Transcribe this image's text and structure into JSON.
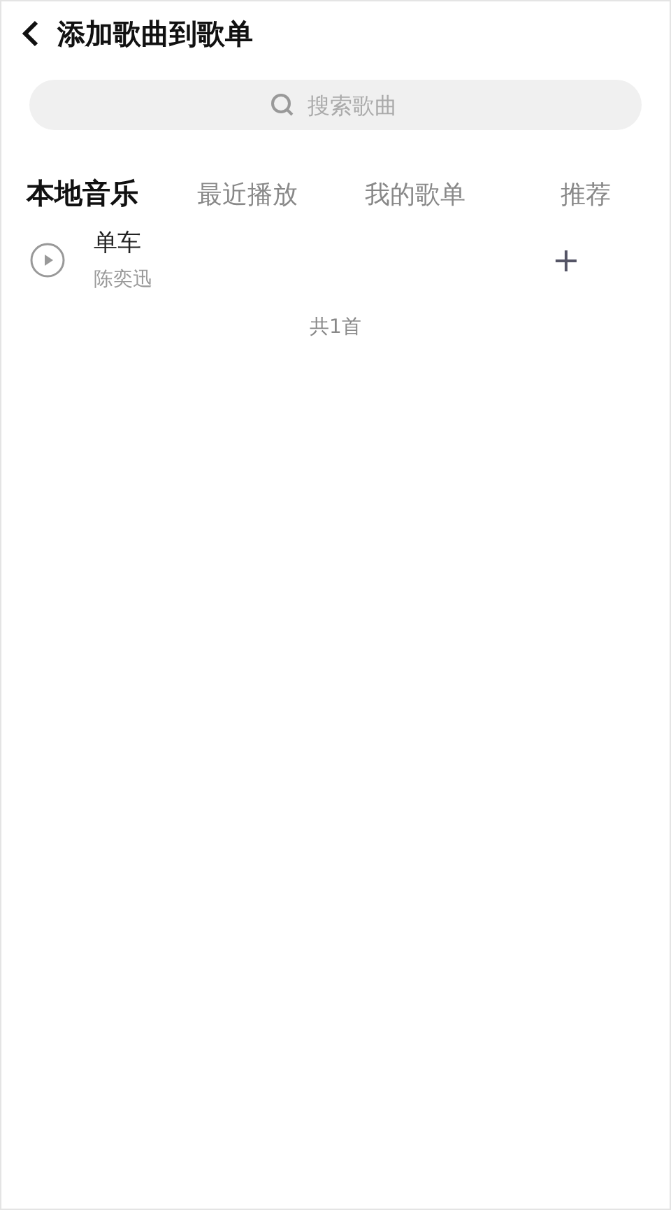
{
  "header": {
    "title": "添加歌曲到歌单"
  },
  "search": {
    "placeholder": "搜索歌曲"
  },
  "tabs": [
    {
      "label": "本地音乐",
      "selected": true
    },
    {
      "label": "最近播放",
      "selected": false
    },
    {
      "label": "我的歌单",
      "selected": false
    },
    {
      "label": "推荐",
      "selected": false
    }
  ],
  "songs": [
    {
      "title": "单车",
      "artist": "陈奕迅",
      "add": "+"
    }
  ],
  "count": "共1首"
}
